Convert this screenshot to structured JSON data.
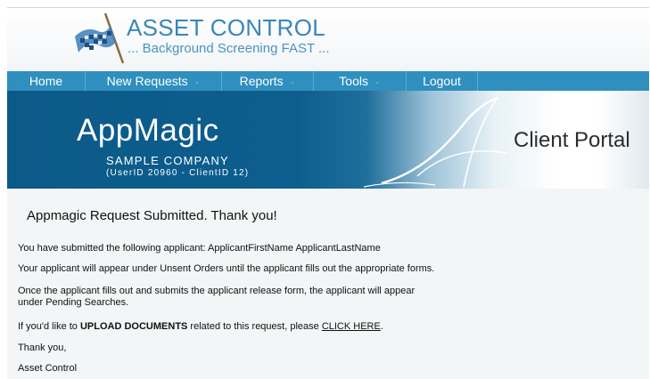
{
  "header": {
    "brand_title": "ASSET CONTROL",
    "brand_tagline": "... Background Screening FAST ...",
    "logo_icon": "checkered-flag-icon"
  },
  "nav": {
    "items": [
      {
        "label": "Home",
        "dropdown": false
      },
      {
        "label": "New Requests",
        "dropdown": true
      },
      {
        "label": "Reports",
        "dropdown": true
      },
      {
        "label": "Tools",
        "dropdown": true
      },
      {
        "label": "Logout",
        "dropdown": false
      }
    ],
    "chevron": "⌄"
  },
  "banner": {
    "app_name": "AppMagic",
    "company": "SAMPLE COMPANY",
    "ids": "(UserID 20960 - ClientID 12)",
    "portal_label": "Client Portal"
  },
  "content": {
    "heading": "Appmagic Request Submitted. Thank you!",
    "line1": "You have submitted the following applicant: ApplicantFirstName ApplicantLastName",
    "line2": "Your applicant will appear under Unsent Orders until the applicant fills out the appropriate forms.",
    "line3a": "Once the applicant fills out and submits the applicant release form, the applicant will appear",
    "line3b": "under Pending Searches.",
    "upload_prefix": "If you'd like to ",
    "upload_strong": "UPLOAD DOCUMENTS",
    "upload_mid": " related to this request, please ",
    "upload_link": "CLICK HERE",
    "upload_suffix": ".",
    "thanks": "Thank you,",
    "signature": "Asset Control"
  },
  "colors": {
    "nav_bg": "#2f8fbf",
    "banner_dark": "#0b5a88",
    "brand_blue": "#3a86b8",
    "content_bg": "#f3f5f6"
  }
}
